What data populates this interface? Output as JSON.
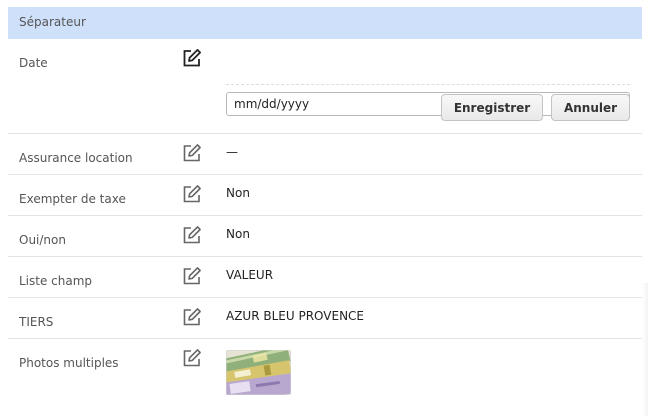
{
  "separator": {
    "label": "Séparateur"
  },
  "fields": {
    "date": {
      "label": "Date",
      "input_value": "mm/dd/yyyy",
      "save_label": "Enregistrer",
      "cancel_label": "Annuler"
    },
    "assurance": {
      "label": "Assurance location",
      "value": "—"
    },
    "exempter": {
      "label": "Exempter de taxe",
      "value": "Non"
    },
    "ouinon": {
      "label": "Oui/non",
      "value": "Non"
    },
    "liste": {
      "label": "Liste champ",
      "value": "VALEUR"
    },
    "tiers": {
      "label": "TIERS",
      "value": "AZUR BLEU PROVENCE"
    },
    "photos": {
      "label": "Photos multiples",
      "thumbnail": "banknotes-photo"
    }
  },
  "icons": {
    "edit": "edit-pencil-icon",
    "calendar": "calendar-icon"
  },
  "colors": {
    "separator_bg": "#cfe0fb",
    "icon": "#333333",
    "border": "#e3e3e3"
  }
}
